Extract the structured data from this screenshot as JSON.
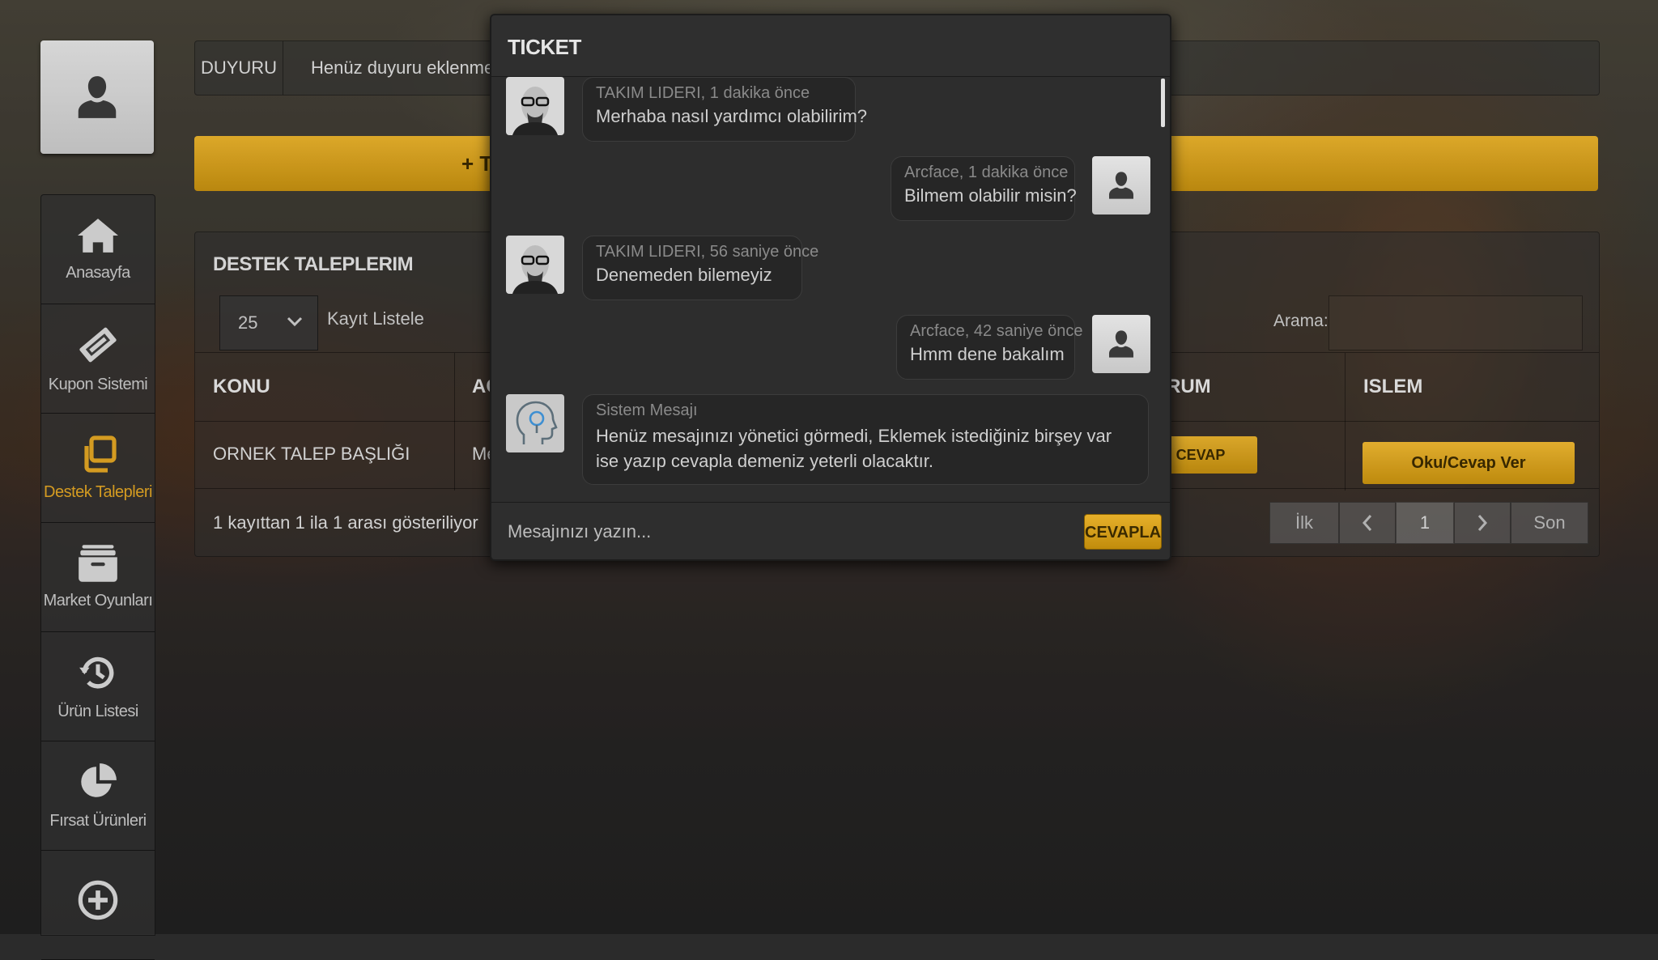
{
  "colors": {
    "accent": "#e0a423",
    "panel": "#2d2d2d"
  },
  "sidebar": {
    "items": [
      {
        "label": "Anasayfa",
        "icon": "home-icon",
        "active": false
      },
      {
        "label": "Kupon Sistemi",
        "icon": "ticket-icon",
        "active": false
      },
      {
        "label": "Destek Talepleri",
        "icon": "copy-icon",
        "active": true
      },
      {
        "label": "Market Oyunları",
        "icon": "archive-icon",
        "active": false
      },
      {
        "label": "Ürün Listesi",
        "icon": "history-icon",
        "active": false
      },
      {
        "label": "Fırsat Ürünleri",
        "icon": "pie-chart-icon",
        "active": false
      },
      {
        "label": "",
        "icon": "plus-circle-icon",
        "active": false
      }
    ]
  },
  "announcement": {
    "tag": "DUYURU",
    "text": "Henüz duyuru eklenmedi."
  },
  "add_button": {
    "label": "+ T"
  },
  "list": {
    "title": "DESTEK TALEPLERIM",
    "length_value": "25",
    "length_label": "Kayıt Listele",
    "search_label": "Arama:",
    "columns": [
      "KONU",
      "AC",
      "RUM",
      "ISLEM"
    ],
    "rows": [
      {
        "subject": "ORNEK TALEP BAŞLIĞI",
        "col2": "Me",
        "status": "CEVAP VERILMEDI",
        "action": "Oku/Cevap Ver"
      }
    ],
    "info": "1 kayıttan 1 ila 1 arası gösteriliyor",
    "pager": {
      "first": "İlk",
      "current": "1",
      "last": "Son"
    }
  },
  "modal": {
    "title": "TICKET",
    "messages": [
      {
        "meta": "TAKIM LIDERI, 1 dakika önce",
        "text": "Merhaba nasıl yardımcı olabilirim?"
      },
      {
        "meta": "Arcface, 1 dakika önce",
        "text": "Bilmem olabilir misin?"
      },
      {
        "meta": "TAKIM LIDERI, 56 saniye önce",
        "text": "Denemeden bilemeyiz"
      },
      {
        "meta": "Arcface, 42 saniye önce",
        "text": "Hmm dene bakalım"
      },
      {
        "meta": "Sistem Mesajı",
        "text": "Henüz mesajınızı yönetici görmedi, Eklemek istediğiniz birşey var ise yazıp cevapla demeniz yeterli olacaktır."
      }
    ],
    "reply_placeholder": "Mesajınızı yazın...",
    "reply_button": "CEVAPLA"
  }
}
